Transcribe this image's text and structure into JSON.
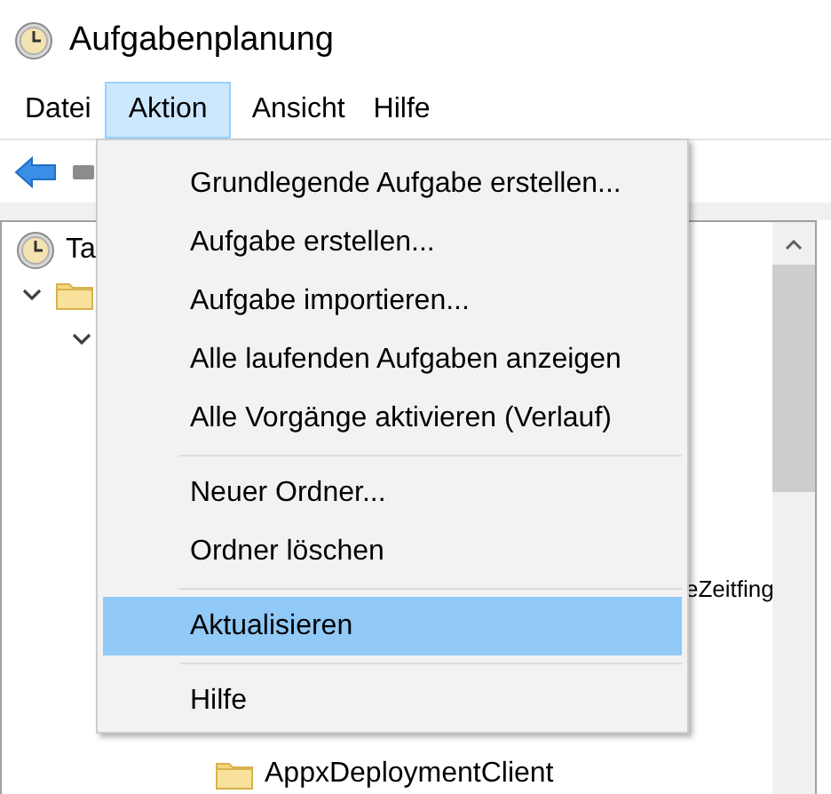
{
  "window": {
    "title": "Aufgabenplanung"
  },
  "menubar": [
    {
      "label": "Datei",
      "selected": false
    },
    {
      "label": "Aktion",
      "selected": true
    },
    {
      "label": "Ansicht",
      "selected": false
    },
    {
      "label": "Hilfe",
      "selected": false
    }
  ],
  "tree": [
    {
      "label": "Ta",
      "children": [
        {
          "expanded": true,
          "children": [
            {
              "expanded": true,
              "children": [
                {
                  "kind": "tail",
                  "label": "eZeitfing"
                },
                {
                  "kind": "folder",
                  "label": "AppxDeploymentClient"
                }
              ]
            }
          ]
        }
      ]
    }
  ],
  "menu": {
    "items": [
      {
        "kind": "item",
        "label": "Grundlegende Aufgabe erstellen...",
        "selected": false
      },
      {
        "kind": "item",
        "label": "Aufgabe erstellen...",
        "selected": false
      },
      {
        "kind": "item",
        "label": "Aufgabe importieren...",
        "selected": false
      },
      {
        "kind": "item",
        "label": "Alle laufenden Aufgaben anzeigen",
        "selected": false
      },
      {
        "kind": "item",
        "label": "Alle Vorgänge aktivieren (Verlauf)",
        "selected": false
      },
      {
        "kind": "separator"
      },
      {
        "kind": "item",
        "label": "Neuer Ordner...",
        "selected": false
      },
      {
        "kind": "item",
        "label": "Ordner löschen",
        "selected": false
      },
      {
        "kind": "separator"
      },
      {
        "kind": "item",
        "label": "Aktualisieren",
        "selected": true
      },
      {
        "kind": "separator"
      },
      {
        "kind": "item",
        "label": "Hilfe",
        "selected": false
      }
    ]
  }
}
